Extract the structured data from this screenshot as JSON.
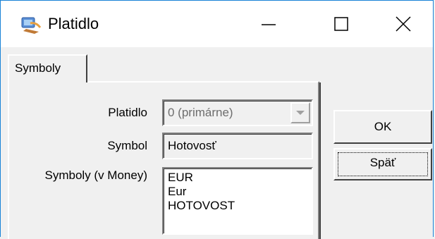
{
  "window": {
    "title": "Platidlo",
    "icon": "app-icon",
    "controls": [
      "minimize-icon",
      "maximize-icon",
      "close-icon"
    ]
  },
  "tabs": [
    {
      "label": "Symboly",
      "active": true
    }
  ],
  "form": {
    "platidlo": {
      "label": "Platidlo",
      "value": "0 (primárne)"
    },
    "symbol": {
      "label": "Symbol",
      "value": "Hotovosť"
    },
    "symboly_money": {
      "label": "Symboly (v Money)",
      "items": [
        "EUR",
        "Eur",
        "HOTOVOST"
      ]
    }
  },
  "buttons": {
    "ok": "OK",
    "back": "Späť"
  }
}
